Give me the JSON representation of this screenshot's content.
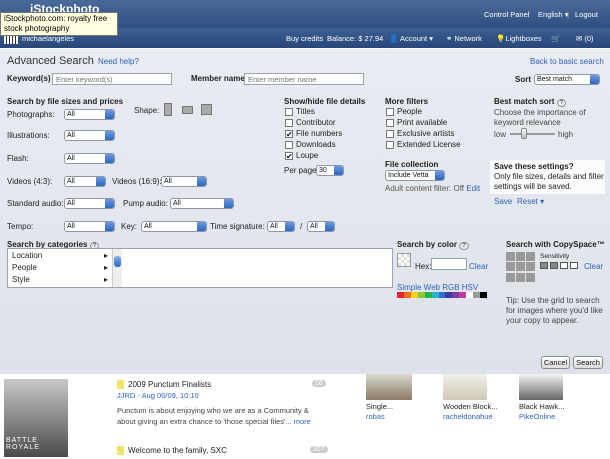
{
  "browser": {
    "tooltip": "iStockphoto.com: royalty free stock photography"
  },
  "header": {
    "logo": "iStockphoto",
    "links": [
      "Control Panel",
      "English",
      "Logout"
    ]
  },
  "userbar": {
    "username": "michaelangeles",
    "buy": "Buy credits",
    "balance": "Balance: $ 27.94",
    "account": "Account",
    "network": "Network",
    "lightboxes": "Lightboxes",
    "messages": "(0)"
  },
  "search": {
    "title": "Advanced Search",
    "help": "Need help?",
    "back": "Back to basic search",
    "keyword_label": "Keyword(s)",
    "keyword_placeholder": "Enter keyword(s)",
    "member_label": "Member name",
    "member_placeholder": "Enter member name",
    "sort_label": "Sort",
    "sort_value": "Best match",
    "by_size": "Search by file sizes and prices",
    "photographs": "Photographs:",
    "illustrations": "Illustrations:",
    "flash": "Flash:",
    "videos43": "Videos (4:3):",
    "videos169": "Videos (16:9):",
    "std_audio": "Standard audio:",
    "pump_audio": "Pump audio:",
    "tempo": "Tempo:",
    "key": "Key:",
    "time_sig": "Time signature:",
    "shape": "Shape:",
    "all": "All",
    "slash": "/",
    "showhide": "Show/hide file details",
    "details": [
      {
        "label": "Titles",
        "on": false
      },
      {
        "label": "Contributor",
        "on": false
      },
      {
        "label": "File numbers",
        "on": true
      },
      {
        "label": "Downloads",
        "on": false
      },
      {
        "label": "Loupe",
        "on": true
      }
    ],
    "per_page_label": "Per page",
    "per_page": "30",
    "more_filters": "More filters",
    "filters": [
      "People",
      "Print available",
      "Exclusive artists",
      "Extended License"
    ],
    "collection_label": "File collection",
    "collection": "Include Vetta",
    "adult": "Adult content filter:",
    "adult_val": "Off",
    "edit": "Edit",
    "best_sort": "Best match sort",
    "best_desc": "Choose the importance of keyword relevance",
    "low": "low",
    "high": "high",
    "save_q": "Save these settings?",
    "save_desc": "Only file sizes, details and filter settings will be saved.",
    "save": "Save",
    "reset": "Reset",
    "categories": "Search by categories",
    "cats": [
      "Location",
      "People",
      "Style"
    ],
    "by_color": "Search by color",
    "hex": "Hex:",
    "clear": "Clear",
    "palettes": "Simple Web RGB HSV",
    "copyspace": "Search with CopySpace™",
    "sensitivity": "Sensitivity",
    "cs_clear": "Clear",
    "tip": "Tip: Use the grid to search for images where you'd like your copy to appear.",
    "cancel": "Cancel",
    "search": "Search"
  },
  "content": {
    "post1_title": "2009 Punctum Finalists",
    "post1_meta": "JJRD - Aug 06/09, 10:10",
    "post1_count": "16",
    "post1_body": "Punctum is about enjoying who we are as a Community & about giving an extra chance to 'those special files'...",
    "more": "more",
    "post2_title": "Welcome to the family, SXC",
    "post2_count": "207",
    "thumb_text": "BATTLE ROYALE",
    "items": [
      {
        "title": "Single...",
        "user": "robas"
      },
      {
        "title": "Wooden Block...",
        "user": "racheldonahue"
      },
      {
        "title": "Black Hawk...",
        "user": "PikeOnline"
      }
    ]
  },
  "colors": {
    "swatches": [
      "#e8242a",
      "#f06d1e",
      "#f3d21a",
      "#8bc53f",
      "#2ab24a",
      "#27b6c9",
      "#2a6fd1",
      "#3b3aa6",
      "#7d3aa0",
      "#c43a9a",
      "#ffffff",
      "#999999",
      "#000000"
    ]
  }
}
